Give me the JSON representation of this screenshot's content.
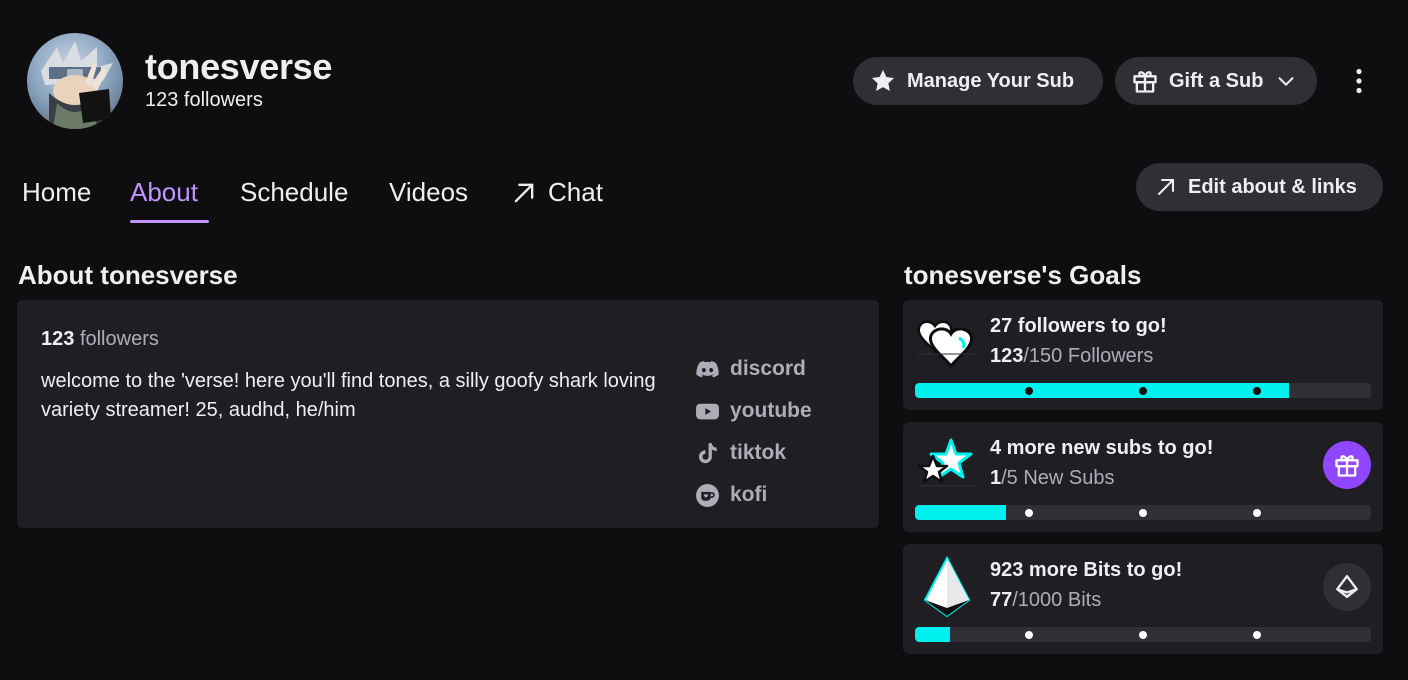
{
  "channel": {
    "name": "tonesverse",
    "followers_label": "123 followers"
  },
  "header_buttons": {
    "manage_sub": "Manage Your Sub",
    "gift_sub": "Gift a Sub"
  },
  "tabs": [
    {
      "label": "Home",
      "active": false
    },
    {
      "label": "About",
      "active": true
    },
    {
      "label": "Schedule",
      "active": false
    },
    {
      "label": "Videos",
      "active": false
    },
    {
      "label": "Chat",
      "active": false
    }
  ],
  "edit_about": "Edit about & links",
  "about": {
    "title": "About tonesverse",
    "follower_number": "123",
    "follower_word": "followers",
    "bio": "welcome to the 'verse! here you'll find tones, a silly goofy shark loving variety streamer! 25, audhd, he/him",
    "links": [
      {
        "label": "discord",
        "icon": "discord-icon"
      },
      {
        "label": "youtube",
        "icon": "youtube-icon"
      },
      {
        "label": "tiktok",
        "icon": "tiktok-icon"
      },
      {
        "label": "kofi",
        "icon": "kofi-icon"
      }
    ]
  },
  "goals": {
    "title": "tonesverse's Goals",
    "items": [
      {
        "headline": "27 followers to go!",
        "current": "123",
        "rest": "/150 Followers",
        "progress": 0.82,
        "icon": "hearts-icon"
      },
      {
        "headline": "4 more new subs to go!",
        "current": "1",
        "rest": "/5 New Subs",
        "progress": 0.2,
        "icon": "stars-icon",
        "action": "gift-icon"
      },
      {
        "headline": "923 more Bits to go!",
        "current": "77",
        "rest": "/1000 Bits",
        "progress": 0.077,
        "icon": "bits-gem-icon",
        "action": "bits-icon"
      }
    ]
  },
  "colors": {
    "background": "#0e0e10",
    "card": "#1f1f23",
    "accent_purple": "#bf94ff",
    "gift_purple": "#9147ff",
    "progress_cyan": "#00f0f0"
  }
}
